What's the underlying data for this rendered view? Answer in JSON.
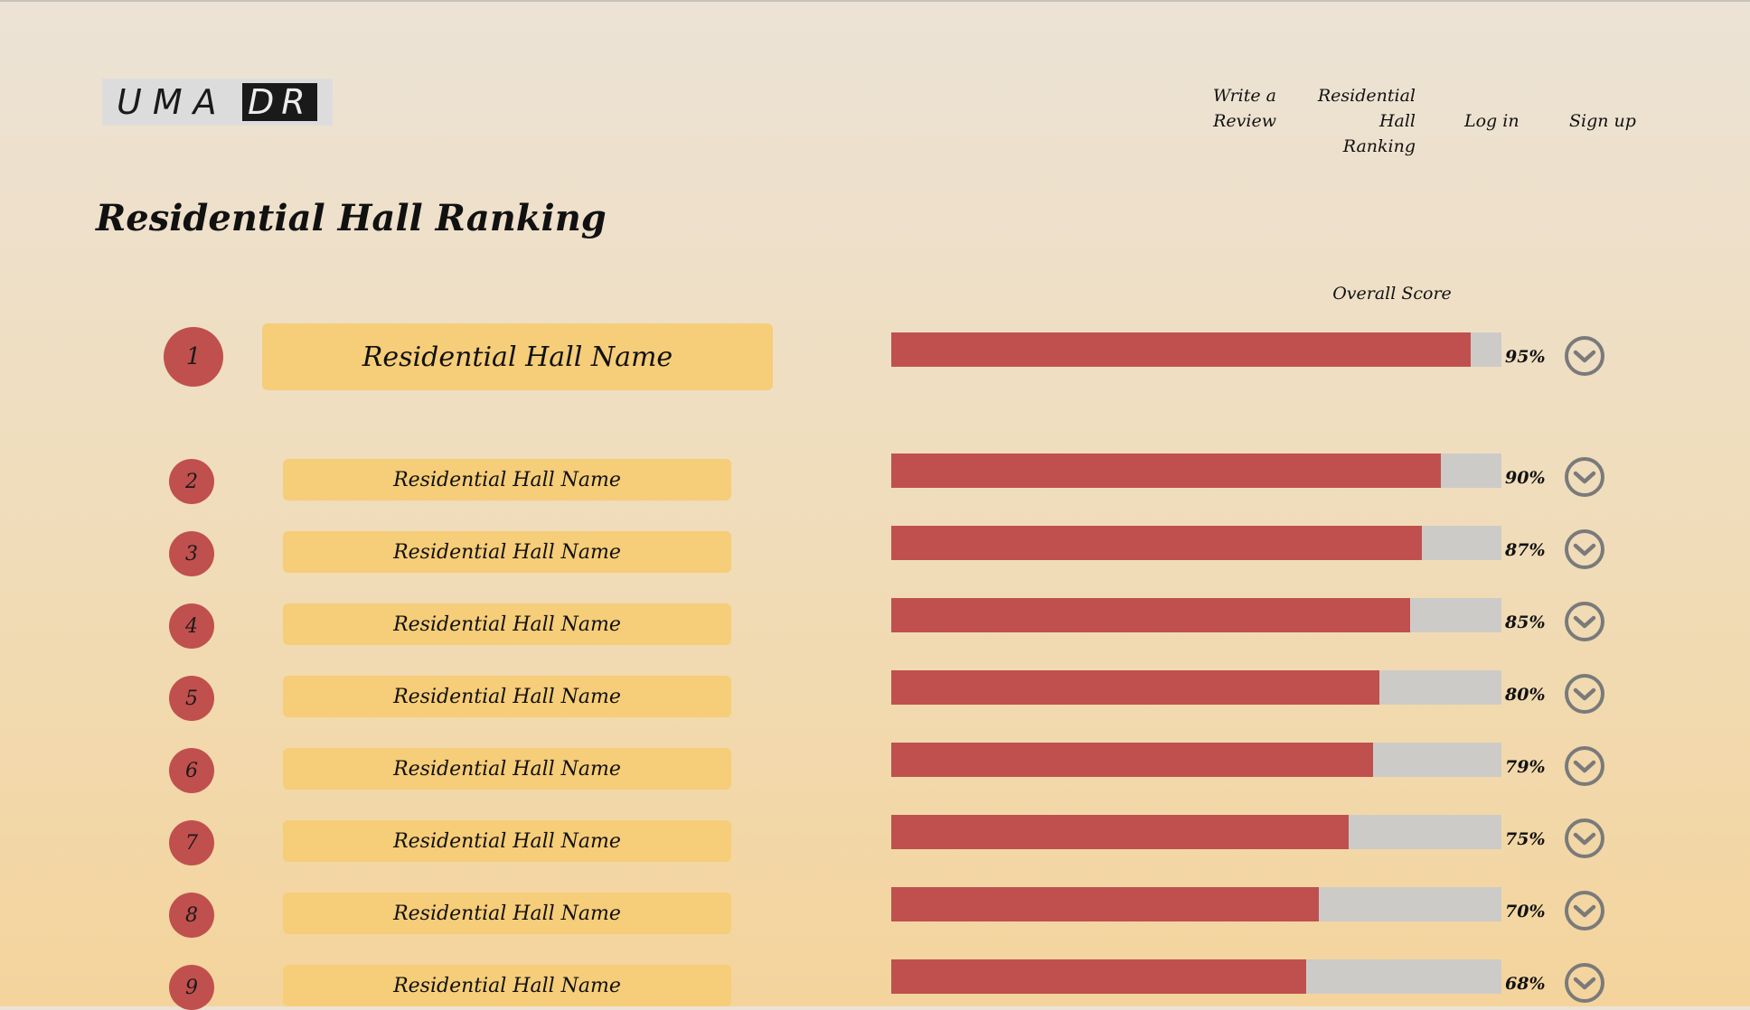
{
  "logo": {
    "left": "UMA",
    "right": "DR"
  },
  "nav": {
    "write_review": "Write a\nReview",
    "ranking": "Residential Hall\nRanking",
    "login": "Log in",
    "signup": "Sign up"
  },
  "page_title": "Residential Hall Ranking",
  "score_header": "Overall Score",
  "colors": {
    "accent_red": "#c0504d",
    "name_box": "#f6cd78",
    "track": "#cdcbc8"
  },
  "halls": [
    {
      "rank": "1",
      "name": "Residential Hall Name",
      "score": 95,
      "score_label": "95%"
    },
    {
      "rank": "2",
      "name": "Residential Hall Name",
      "score": 90,
      "score_label": "90%"
    },
    {
      "rank": "3",
      "name": "Residential Hall Name",
      "score": 87,
      "score_label": "87%"
    },
    {
      "rank": "4",
      "name": "Residential Hall Name",
      "score": 85,
      "score_label": "85%"
    },
    {
      "rank": "5",
      "name": "Residential Hall Name",
      "score": 80,
      "score_label": "80%"
    },
    {
      "rank": "6",
      "name": "Residential Hall Name",
      "score": 79,
      "score_label": "79%"
    },
    {
      "rank": "7",
      "name": "Residential Hall Name",
      "score": 75,
      "score_label": "75%"
    },
    {
      "rank": "8",
      "name": "Residential Hall Name",
      "score": 70,
      "score_label": "70%"
    },
    {
      "rank": "9",
      "name": "Residential Hall Name",
      "score": 68,
      "score_label": "68%"
    }
  ],
  "icons": {
    "expand": "chevron-down-circle-icon"
  }
}
